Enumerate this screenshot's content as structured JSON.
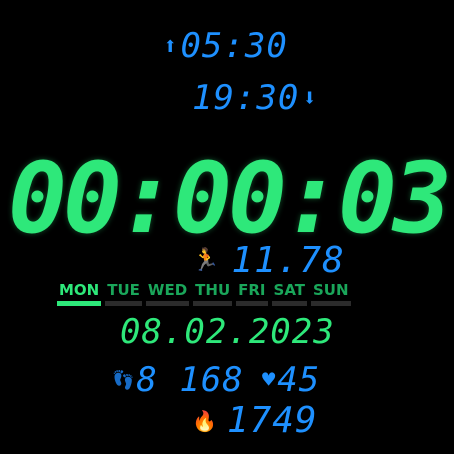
{
  "sunrise": {
    "time": "05:30",
    "icon": "arrow-up-icon"
  },
  "sunset": {
    "time": "19:30",
    "icon": "arrow-down-icon"
  },
  "clock": {
    "time": "00:00:03"
  },
  "distance": {
    "value": "11.78",
    "icon": "running-person-icon"
  },
  "weekdays": [
    {
      "label": "MON",
      "color": "#2ee87a",
      "active": true
    },
    {
      "label": "TUE",
      "color": "#1aa65a"
    },
    {
      "label": "WED",
      "color": "#1aa65a"
    },
    {
      "label": "THU",
      "color": "#1aa65a"
    },
    {
      "label": "FRI",
      "color": "#1aa65a"
    },
    {
      "label": "SAT",
      "color": "#1aa65a"
    },
    {
      "label": "SUN",
      "color": "#1aa65a"
    }
  ],
  "date": "08.02.2023",
  "steps": {
    "value": "8 168",
    "icon": "footprints-icon"
  },
  "heart": {
    "value": "45",
    "icon": "heart-pulse-icon"
  },
  "calories": {
    "value": "1749",
    "icon": "flame-icon"
  },
  "colors": {
    "green": "#2ee87a",
    "blue": "#1e90ff",
    "background": "#000000"
  }
}
